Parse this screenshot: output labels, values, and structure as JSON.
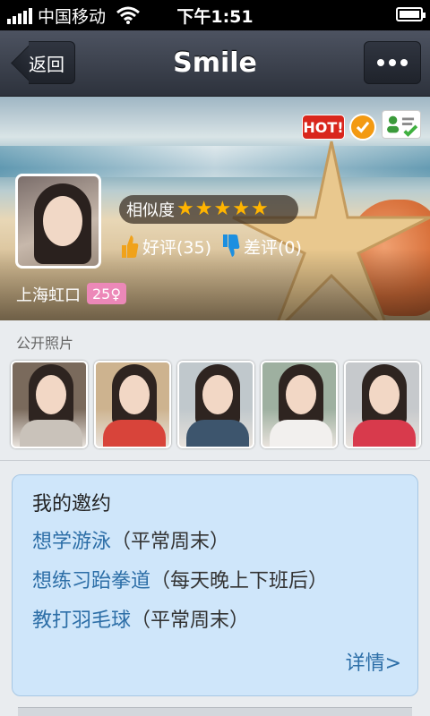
{
  "status_bar": {
    "carrier": "中国移动",
    "time": "下午1:51"
  },
  "nav": {
    "back_label": "返回",
    "title": "Smile"
  },
  "profile": {
    "badge_hot": "HOT!",
    "similarity_label": "相似度",
    "similarity_stars": 5,
    "good_reviews": "好评(35)",
    "bad_reviews": "差评(0)",
    "location": "上海虹口",
    "age_gender": "25♀"
  },
  "photos": {
    "title": "公开照片",
    "items": [
      {
        "top": "#7a6a5c",
        "body": "#c9c2ba"
      },
      {
        "top": "#cdb38f",
        "body": "#d8443a"
      },
      {
        "top": "#c0c8cc",
        "body": "#3d556d"
      },
      {
        "top": "#9eb0a0",
        "body": "#f2f0ee"
      },
      {
        "top": "#c6c9cc",
        "body": "#d83a4c"
      }
    ]
  },
  "invitation": {
    "title": "我的邀约",
    "items": [
      {
        "text": "想学游泳",
        "note": "（平常周末）"
      },
      {
        "text": "想练习跆拳道",
        "note": "（每天晚上下班后）"
      },
      {
        "text": "教打羽毛球",
        "note": "（平常周末）"
      }
    ],
    "more_label": "详情>"
  },
  "icons": [
    "back-chevron-icon",
    "more-dots-icon",
    "wifi-icon",
    "battery-icon",
    "check-badge-icon",
    "id-card-icon",
    "star-icon",
    "thumbs-up-icon",
    "thumbs-down-icon"
  ]
}
